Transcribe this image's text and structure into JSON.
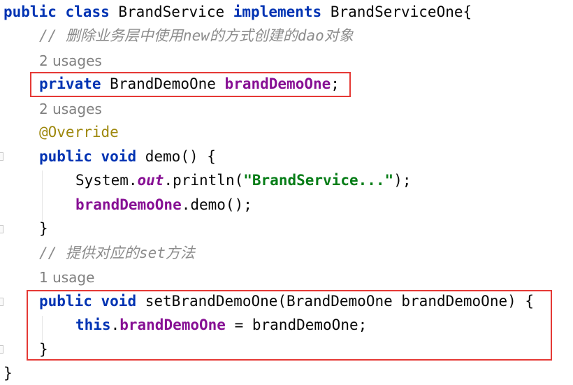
{
  "editor": {
    "lines": {
      "l1": {
        "kw_public": "public",
        "kw_class": "class",
        "class_name": "BrandService",
        "kw_implements": "implements",
        "interface_brace": "BrandServiceOne{"
      },
      "l2": {
        "comment": "// 删除业务层中使用new的方式创建的dao对象"
      },
      "l3": {
        "usages": "2 usages"
      },
      "l4": {
        "kw_private": "private",
        "type": "BrandDemoOne",
        "field": "brandDemoOne",
        "semicolon": ";"
      },
      "l5": {
        "usages": "2 usages"
      },
      "l6": {
        "annotation": "@Override"
      },
      "l7": {
        "kw_public": "public",
        "kw_void": "void",
        "signature": "demo() {"
      },
      "l8": {
        "prefix": "System.",
        "static_field": "out",
        "call": ".println(",
        "string": "\"BrandService...\"",
        "suffix": ");"
      },
      "l9": {
        "field": "brandDemoOne",
        "call": ".demo();"
      },
      "l10": {
        "brace": "}"
      },
      "l11": {
        "comment": "// 提供对应的set方法"
      },
      "l12": {
        "usages": "1 usage"
      },
      "l13": {
        "kw_public": "public",
        "kw_void": "void",
        "signature": "setBrandDemoOne(BrandDemoOne brandDemoOne) {"
      },
      "l14": {
        "kw_this": "this",
        "dot": ".",
        "field": "brandDemoOne",
        "assign": " = brandDemoOne;"
      },
      "l15": {
        "brace": "}"
      },
      "l16": {
        "brace": "}"
      }
    },
    "colors": {
      "keyword": "#0033b3",
      "field": "#871094",
      "string": "#067d17",
      "comment": "#8c8c8c",
      "annotation": "#9e880d",
      "highlight_box": "#e53935"
    }
  }
}
